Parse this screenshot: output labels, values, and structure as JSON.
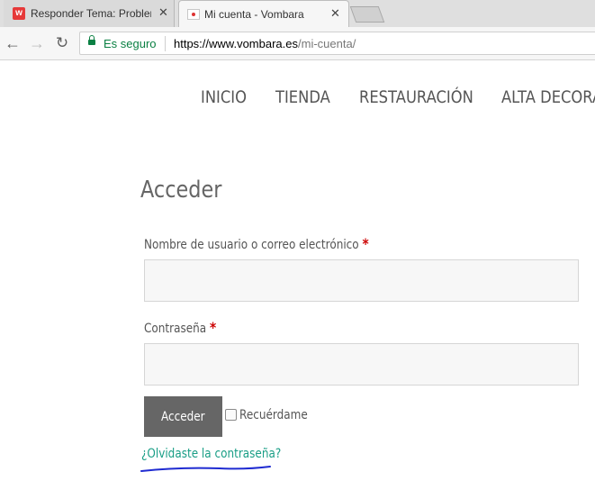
{
  "browser": {
    "tabs": [
      {
        "title": "Responder Tema: Problem",
        "icon": "wordfence-w-icon",
        "active": false
      },
      {
        "title": "Mi cuenta - Vombara",
        "icon": "page-icon",
        "active": true
      }
    ],
    "tab_close_glyph": "✕",
    "favicon_letter": "w",
    "security_label": "Es seguro",
    "url_host": "https://www.vombara.es",
    "url_path": "/mi-cuenta/",
    "secure_color": "#0b8043"
  },
  "nav": {
    "items": [
      "INICIO",
      "TIENDA",
      "RESTAURACIÓN",
      "ALTA DECORA"
    ]
  },
  "login": {
    "heading": "Acceder",
    "username_label": "Nombre de usuario o correo electrónico",
    "password_label": "Contraseña",
    "required_mark": "*",
    "username_value": "",
    "password_value": "",
    "submit_label": "Acceder",
    "remember_label": "Recuérdame",
    "remember_checked": false,
    "lost_password_link": "¿Olvidaste la contraseña?"
  },
  "colors": {
    "accent_link": "#1a9e86",
    "button_bg": "#666666",
    "required": "#cc0000",
    "scribble": "#1f2bd1"
  }
}
